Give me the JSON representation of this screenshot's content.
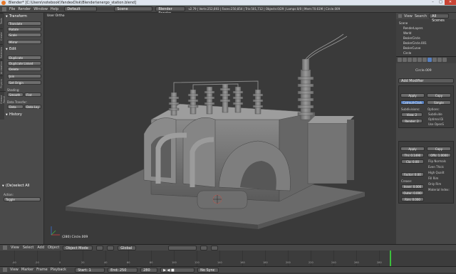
{
  "window": {
    "title": "Blender* [C:\\Users\\notebook\\YandexDisk\\Blender\\energo_station.blend]",
    "min": "–",
    "max": "□",
    "close": "✕"
  },
  "info_bar": {
    "menus": [
      "File",
      "Render",
      "Window",
      "Help"
    ],
    "layout": "Default",
    "scene": "Scene",
    "engine": "Blender Render",
    "stats": "v2.79 | Verts:252,693 | Faces:250,854 | Tris:501,712 | Objects:0/29 | Lamps:0/0 | Mem:70.61M | Circle.009"
  },
  "toolshelf": {
    "tabs": [
      "Tools",
      "Create",
      "Relations",
      "Animation",
      "Physics",
      "Grease Pencil"
    ],
    "transform_header": "Transform",
    "transform": [
      "Translate",
      "Rotate",
      "Scale"
    ],
    "mirror": "Mirror",
    "edit_header": "Edit",
    "edit": [
      "Duplicate",
      "Duplicate Linked",
      "Delete"
    ],
    "join": "Join",
    "set_origin": "Set Origin",
    "shading_label": "Shading:",
    "smooth": "Smooth",
    "flat": "Flat",
    "data_transfer_label": "Data Transfer:",
    "data": "Data",
    "data_lay": "Data Lay",
    "history_header": "History",
    "operator_header": "(De)select All",
    "action_label": "Action:",
    "action_value": "Toggle"
  },
  "viewport": {
    "view_label": "User Ortho",
    "object_label": "(280) Circle.009"
  },
  "outliner": {
    "view": "View",
    "search": "Search",
    "scenes": "All Scenes",
    "items": [
      "Scene",
      "RenderLayers",
      "World",
      "BezierCircle",
      "BezierCircle.001",
      "BezierCurve",
      "Circle"
    ]
  },
  "properties": {
    "object_name": "Circle.009",
    "add_modifier": "Add Modifier",
    "mod1": {
      "apply": "Apply",
      "copy": "Copy",
      "catmull": "Catmull-Clark",
      "simple": "Simple",
      "subdiv_label": "Subdivisions:",
      "options_label": "Options:",
      "view": "View: 2",
      "render": "Render: 2",
      "subuv": "Subdivide",
      "optimal": "Optimal Di",
      "opensub": "Use OpenS"
    },
    "mod2": {
      "apply": "Apply",
      "copy": "Copy",
      "thickness": "Thi: 0.1490",
      "offset": "Offs: 1.0000",
      "clamp": "Cla: 0.00",
      "flip": "Flip Normals",
      "even": "Even Thick",
      "high": "High Qualit",
      "factor": "Factor: 0.00",
      "fill_rim": "Fill Rim",
      "only_rim": "Only Rim",
      "crease": "Crease:",
      "inner": "Inner: 0.000",
      "outer": "Outer: 0.000",
      "rim": "Rim: 0.000",
      "material": "Material Index:"
    }
  },
  "view_header": {
    "menus": [
      "View",
      "Select",
      "Add",
      "Object"
    ],
    "mode": "Object Mode",
    "orientation": "Global"
  },
  "timeline": {
    "ticks": [
      "-40",
      "-20",
      "0",
      "20",
      "40",
      "60",
      "80",
      "100",
      "120",
      "140",
      "160",
      "180",
      "200",
      "220",
      "240",
      "260",
      "280"
    ],
    "menus": [
      "View",
      "Marker",
      "Frame",
      "Playback"
    ],
    "start": "Start: 1",
    "end": "End: 250",
    "current": "280",
    "sync": "No Sync"
  }
}
